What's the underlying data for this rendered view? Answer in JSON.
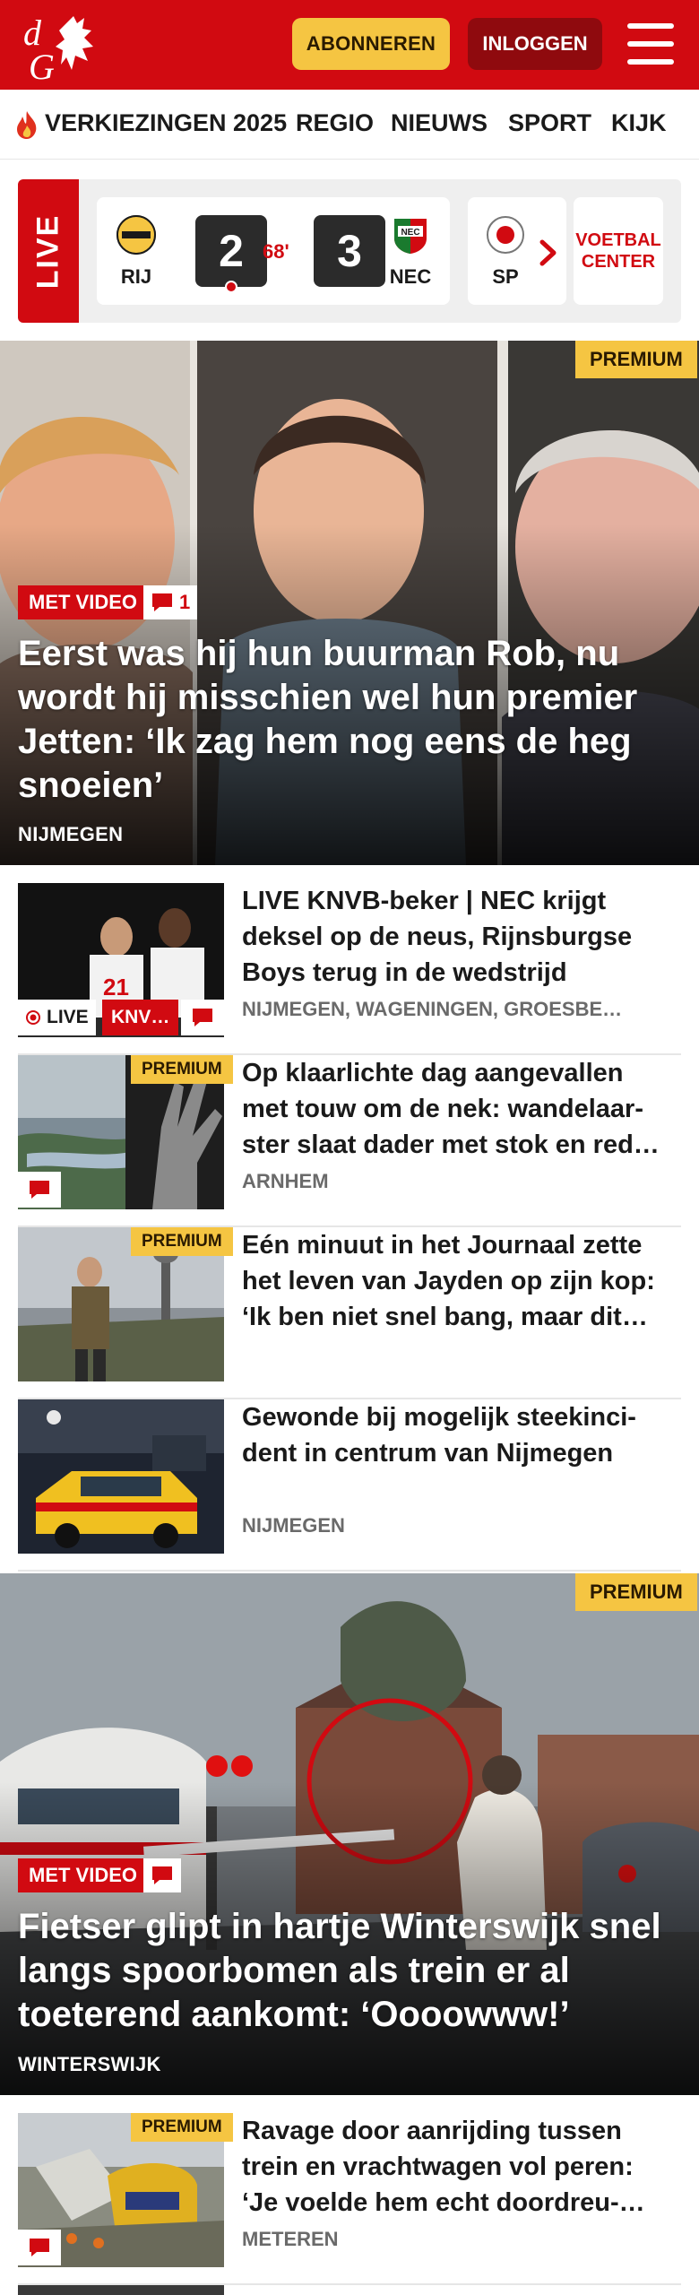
{
  "header": {
    "logo_text": "dG",
    "subscribe_label": "ABONNEREN",
    "login_label": "INLOGGEN"
  },
  "nav": {
    "items": [
      "VERKIEZINGEN 2025",
      "REGIO",
      "NIEUWS",
      "SPORT",
      "KIJK"
    ]
  },
  "live_scores": {
    "live_label": "LIVE",
    "match": {
      "home": "RIJ",
      "home_score": "2",
      "minute": "68'",
      "away_score": "3",
      "away": "NEC"
    },
    "next_club": "SP",
    "voetbal_center": "VOETBAL CENTER"
  },
  "hero1": {
    "premium": "PREMIUM",
    "video_label": "MET VIDEO",
    "comments": "1",
    "title": "Eerst was hij hun buurman Rob, nu wordt hij misschien wel hun premier Jetten: ‘Ik zag hem nog eens de heg snoeien’",
    "location": "NIJMEGEN"
  },
  "articles": [
    {
      "title": "LIVE KNVB-beker | NEC krijgt deksel op de neus, Rijnsburgse Boys terug in de wedstrijd",
      "location": "NIJMEGEN, WAGENINGEN, GROESBE…",
      "live_label": "LIVE",
      "tag": "KNV…"
    },
    {
      "premium": "PREMIUM",
      "title": "Op klaarlichte dag aangevallen met touw om de nek: wandelaar­ster slaat dader met stok en red…",
      "location": "ARNHEM"
    },
    {
      "premium": "PREMIUM",
      "title": "Eén minuut in het Journaal zette het leven van Jayden op zijn kop: ‘Ik ben niet snel bang, maar dit…",
      "location": ""
    },
    {
      "title": "Gewonde bij mogelijk steekinci­dent in centrum van Nijmegen",
      "location": "NIJMEGEN"
    }
  ],
  "hero2": {
    "premium": "PREMIUM",
    "video_label": "MET VIDEO",
    "title": "Fietser glipt in hartje Winterswijk snel langs spoorbomen als trein er al toeterend aankomt: ‘Oooowww!’",
    "location": "WINTERSWIJK"
  },
  "article_last": {
    "premium": "PREMIUM",
    "title": "Ravage door aanrijding tussen trein en vrachtwagen vol peren: ‘Je voelde hem echt doordreu-…",
    "location": "METEREN"
  },
  "colors": {
    "brand_red": "#d10a11",
    "premium_yellow": "#f5c542",
    "dark_red": "#8f0a0e"
  }
}
